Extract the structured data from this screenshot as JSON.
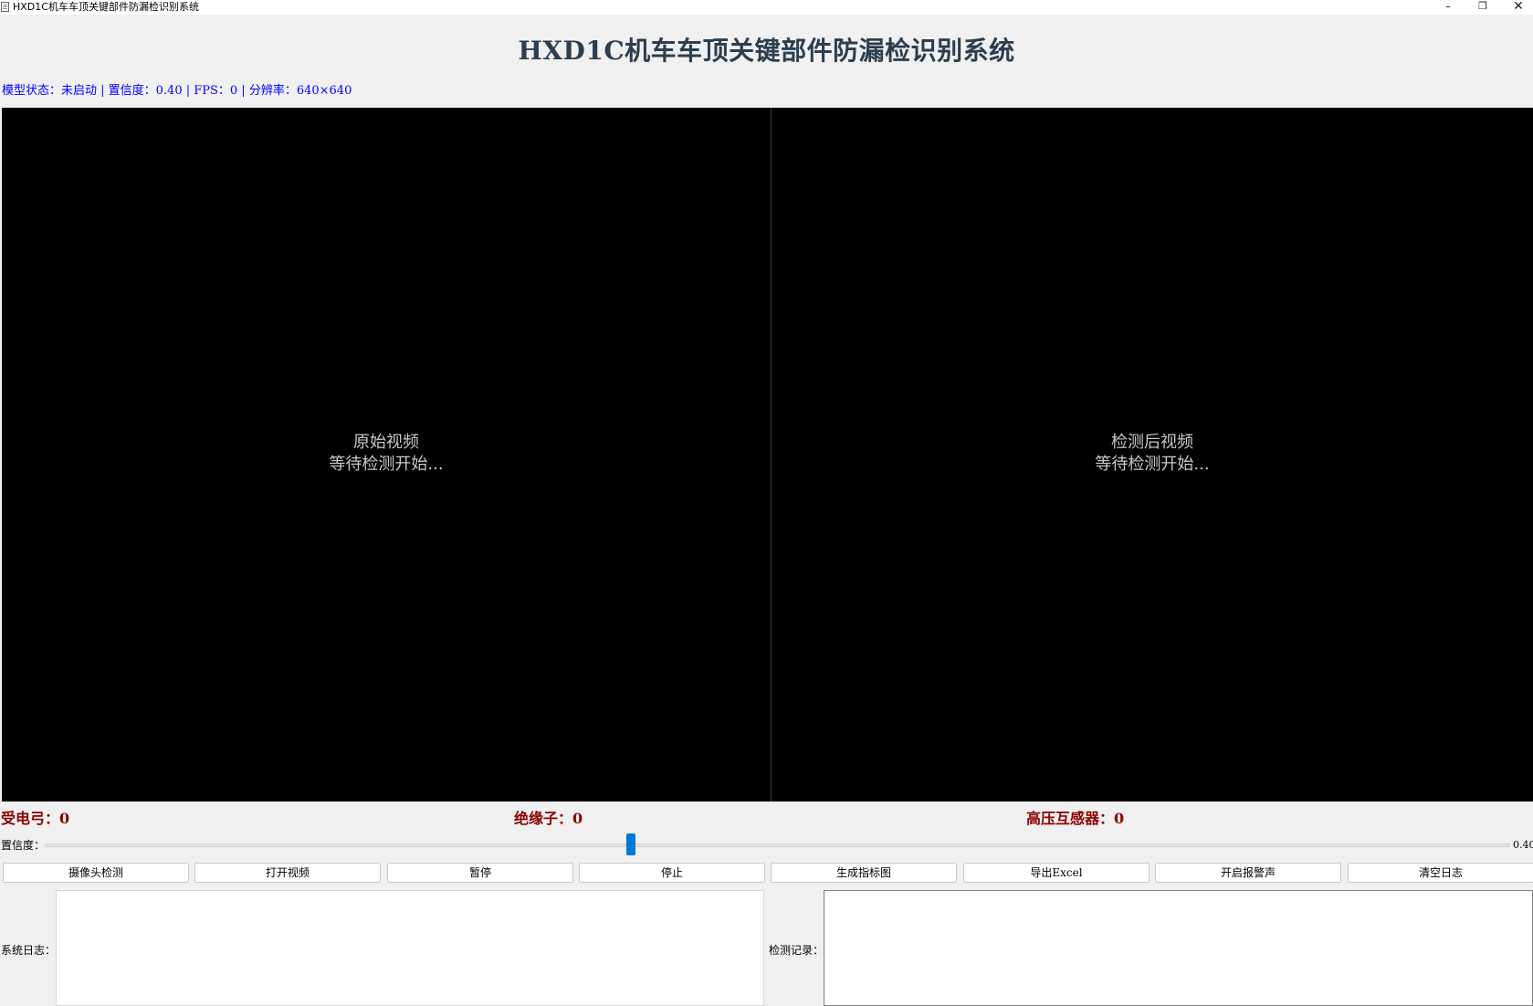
{
  "window": {
    "title": "HXD1C机车车顶关键部件防漏检识别系统",
    "minimize_glyph": "–",
    "restore_glyph": "❐",
    "close_glyph": "✕"
  },
  "header": {
    "title": "HXD1C机车车顶关键部件防漏检识别系统",
    "status_line": "模型状态：未启动 | 置信度：0.40 | FPS：0 | 分辨率：640×640"
  },
  "videos": {
    "original": {
      "title": "原始视频",
      "waiting": "等待检测开始..."
    },
    "detected": {
      "title": "检测后视频",
      "waiting": "等待检测开始..."
    }
  },
  "counts": {
    "pantograph": "受电弓：0",
    "insulator": "绝缘子：0",
    "hv_transformer": "高压互感器：0"
  },
  "confidence": {
    "label": "置信度：",
    "value": 0.4,
    "value_text": "0.40"
  },
  "buttons": {
    "camera": "摄像头检测",
    "open_video": "打开视频",
    "pause": "暂停",
    "stop": "停止",
    "generate_chart": "生成指标图",
    "export_excel": "导出Excel",
    "alarm": "开启报警声",
    "clear_log": "清空日志"
  },
  "logs": {
    "system_label": "系统日志：",
    "detection_label": "检测记录："
  },
  "colors": {
    "heading": "#2c3e50",
    "status": "#0000ff",
    "count": "#8b0000",
    "slider_handle": "#0078d7",
    "video_bg": "#000000"
  }
}
